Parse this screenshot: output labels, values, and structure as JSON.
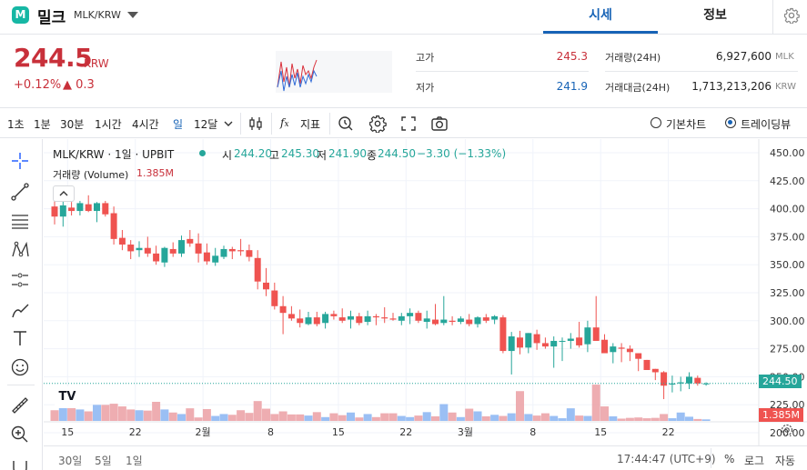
{
  "header": {
    "coin_name": "밀크",
    "pair": "MLK/KRW",
    "tabs": [
      "시세",
      "정보"
    ],
    "active_tab": 0
  },
  "price": {
    "current": "244.5",
    "unit": "KRW",
    "change_pct": "+0.12%",
    "change_abs": "▲ 0.3",
    "stats": {
      "high_label": "고가",
      "high_value": "245.3",
      "low_label": "저가",
      "low_value": "241.9",
      "volume_label": "거래량(24H)",
      "volume_value": "6,927,600",
      "volume_unit": "MLK",
      "amount_label": "거래대금(24H)",
      "amount_value": "1,713,213,206",
      "amount_unit": "KRW"
    }
  },
  "toolbar": {
    "intervals": [
      "1초",
      "1분",
      "30분",
      "1시간",
      "4시간",
      "일",
      "12달"
    ],
    "active_interval": "일",
    "fx_label": "지표",
    "mode_basic": "기본차트",
    "mode_trading": "트레이딩뷰"
  },
  "chart": {
    "legend_title": "MLK/KRW · 1일 · UPBIT",
    "ohlc": {
      "o_label": "시",
      "o": "244.20",
      "h_label": "고",
      "h": "245.30",
      "l_label": "저",
      "l": "241.90",
      "c_label": "종",
      "c": "244.50",
      "chg": "−3.30 (−1.33%)"
    },
    "volume_label": "거래량 (Volume)",
    "volume_value": "1.385M",
    "logo_text": "TV",
    "y_ticks": [
      "450.00",
      "425.00",
      "400.00",
      "375.00",
      "350.00",
      "325.00",
      "300.00",
      "275.00",
      "250.00",
      "225.00",
      "200.00"
    ],
    "x_ticks": [
      "15",
      "22",
      "2월",
      "8",
      "15",
      "22",
      "3월",
      "8",
      "15",
      "22"
    ],
    "last_price_tag": "244.50",
    "last_volume_tag": "1.385M",
    "ranges": [
      "30일",
      "5일",
      "1일"
    ],
    "clock": "17:44:47 (UTC+9)",
    "pct_label": "%",
    "log_label": "로그",
    "auto_label": "자동"
  },
  "colors": {
    "up": "#26a69a",
    "down": "#ef5350",
    "accent": "#1763b6",
    "price_red": "#c8303a"
  },
  "chart_data": {
    "type": "candlestick",
    "title": "MLK/KRW · 1일 · UPBIT",
    "ylim": [
      200,
      450
    ],
    "candles": [
      {
        "o": 402,
        "h": 408,
        "l": 386,
        "c": 393
      },
      {
        "o": 393,
        "h": 410,
        "l": 384,
        "c": 403
      },
      {
        "o": 401,
        "h": 406,
        "l": 394,
        "c": 398
      },
      {
        "o": 398,
        "h": 407,
        "l": 394,
        "c": 405
      },
      {
        "o": 404,
        "h": 412,
        "l": 397,
        "c": 398
      },
      {
        "o": 398,
        "h": 406,
        "l": 388,
        "c": 405
      },
      {
        "o": 405,
        "h": 407,
        "l": 393,
        "c": 395
      },
      {
        "o": 396,
        "h": 402,
        "l": 368,
        "c": 373
      },
      {
        "o": 374,
        "h": 381,
        "l": 363,
        "c": 368
      },
      {
        "o": 368,
        "h": 372,
        "l": 355,
        "c": 362
      },
      {
        "o": 363,
        "h": 371,
        "l": 357,
        "c": 365
      },
      {
        "o": 365,
        "h": 375,
        "l": 357,
        "c": 360
      },
      {
        "o": 360,
        "h": 367,
        "l": 350,
        "c": 353
      },
      {
        "o": 352,
        "h": 366,
        "l": 348,
        "c": 365
      },
      {
        "o": 364,
        "h": 370,
        "l": 357,
        "c": 360
      },
      {
        "o": 360,
        "h": 376,
        "l": 357,
        "c": 372
      },
      {
        "o": 373,
        "h": 381,
        "l": 366,
        "c": 369
      },
      {
        "o": 369,
        "h": 378,
        "l": 352,
        "c": 360
      },
      {
        "o": 361,
        "h": 369,
        "l": 350,
        "c": 353
      },
      {
        "o": 352,
        "h": 365,
        "l": 349,
        "c": 358
      },
      {
        "o": 357,
        "h": 367,
        "l": 355,
        "c": 364
      },
      {
        "o": 364,
        "h": 366,
        "l": 355,
        "c": 362
      },
      {
        "o": 363,
        "h": 373,
        "l": 358,
        "c": 362
      },
      {
        "o": 363,
        "h": 368,
        "l": 353,
        "c": 357
      },
      {
        "o": 356,
        "h": 363,
        "l": 328,
        "c": 335
      },
      {
        "o": 334,
        "h": 347,
        "l": 322,
        "c": 328
      },
      {
        "o": 327,
        "h": 334,
        "l": 310,
        "c": 313
      },
      {
        "o": 313,
        "h": 322,
        "l": 288,
        "c": 307
      },
      {
        "o": 306,
        "h": 313,
        "l": 300,
        "c": 302
      },
      {
        "o": 302,
        "h": 310,
        "l": 294,
        "c": 298
      },
      {
        "o": 297,
        "h": 308,
        "l": 296,
        "c": 303
      },
      {
        "o": 303,
        "h": 308,
        "l": 295,
        "c": 297
      },
      {
        "o": 298,
        "h": 308,
        "l": 293,
        "c": 306
      },
      {
        "o": 306,
        "h": 309,
        "l": 301,
        "c": 304
      },
      {
        "o": 303,
        "h": 311,
        "l": 298,
        "c": 300
      },
      {
        "o": 301,
        "h": 309,
        "l": 293,
        "c": 304
      },
      {
        "o": 304,
        "h": 307,
        "l": 296,
        "c": 298
      },
      {
        "o": 299,
        "h": 309,
        "l": 296,
        "c": 304
      },
      {
        "o": 304,
        "h": 306,
        "l": 296,
        "c": 303
      },
      {
        "o": 303,
        "h": 312,
        "l": 298,
        "c": 302
      },
      {
        "o": 302,
        "h": 307,
        "l": 300,
        "c": 301
      },
      {
        "o": 300,
        "h": 307,
        "l": 296,
        "c": 304
      },
      {
        "o": 304,
        "h": 311,
        "l": 297,
        "c": 307
      },
      {
        "o": 307,
        "h": 309,
        "l": 298,
        "c": 300
      },
      {
        "o": 299,
        "h": 309,
        "l": 293,
        "c": 302
      },
      {
        "o": 301,
        "h": 315,
        "l": 296,
        "c": 297
      },
      {
        "o": 298,
        "h": 322,
        "l": 296,
        "c": 301
      },
      {
        "o": 300,
        "h": 304,
        "l": 296,
        "c": 299
      },
      {
        "o": 299,
        "h": 304,
        "l": 297,
        "c": 302
      },
      {
        "o": 301,
        "h": 306,
        "l": 295,
        "c": 297
      },
      {
        "o": 297,
        "h": 304,
        "l": 294,
        "c": 303
      },
      {
        "o": 303,
        "h": 306,
        "l": 298,
        "c": 300
      },
      {
        "o": 301,
        "h": 305,
        "l": 297,
        "c": 304
      },
      {
        "o": 303,
        "h": 305,
        "l": 271,
        "c": 273
      },
      {
        "o": 273,
        "h": 290,
        "l": 252,
        "c": 286
      },
      {
        "o": 285,
        "h": 291,
        "l": 270,
        "c": 276
      },
      {
        "o": 276,
        "h": 289,
        "l": 271,
        "c": 289
      },
      {
        "o": 288,
        "h": 292,
        "l": 274,
        "c": 280
      },
      {
        "o": 280,
        "h": 285,
        "l": 275,
        "c": 277
      },
      {
        "o": 277,
        "h": 286,
        "l": 258,
        "c": 282
      },
      {
        "o": 282,
        "h": 285,
        "l": 264,
        "c": 282
      },
      {
        "o": 282,
        "h": 289,
        "l": 275,
        "c": 284
      },
      {
        "o": 285,
        "h": 299,
        "l": 276,
        "c": 278
      },
      {
        "o": 279,
        "h": 300,
        "l": 272,
        "c": 294
      },
      {
        "o": 294,
        "h": 322,
        "l": 283,
        "c": 282
      },
      {
        "o": 283,
        "h": 288,
        "l": 273,
        "c": 271
      },
      {
        "o": 272,
        "h": 280,
        "l": 262,
        "c": 277
      },
      {
        "o": 276,
        "h": 280,
        "l": 263,
        "c": 275
      },
      {
        "o": 275,
        "h": 278,
        "l": 264,
        "c": 272
      },
      {
        "o": 271,
        "h": 270,
        "l": 255,
        "c": 266
      },
      {
        "o": 265,
        "h": 258,
        "l": 257,
        "c": 256
      },
      {
        "o": 257,
        "h": 256,
        "l": 247,
        "c": 254
      },
      {
        "o": 254,
        "h": 255,
        "l": 230,
        "c": 242
      },
      {
        "o": 243,
        "h": 251,
        "l": 236,
        "c": 244
      },
      {
        "o": 244,
        "h": 250,
        "l": 237,
        "c": 245
      },
      {
        "o": 244,
        "h": 254,
        "l": 239,
        "c": 250
      },
      {
        "o": 249,
        "h": 251,
        "l": 242,
        "c": 244
      },
      {
        "o": 244,
        "h": 245,
        "l": 242,
        "c": 244
      }
    ],
    "volume_relative": [
      0.28,
      0.44,
      0.76,
      0.3,
      0.25,
      0.42,
      0.42,
      0.45,
      0.38,
      0.3,
      0.28,
      0.27,
      0.5,
      0.3,
      0.22,
      0.18,
      0.33,
      0.09,
      0.31,
      0.13,
      0.18,
      0.16,
      0.28,
      0.21,
      0.52,
      0.32,
      0.18,
      0.25,
      0.17,
      0.17,
      0.14,
      0.23,
      0.1,
      0.2,
      0.15,
      0.22,
      0.09,
      0.18,
      0.1,
      0.2,
      0.2,
      0.13,
      0.1,
      0.14,
      0.23,
      0.12,
      0.44,
      0.22,
      0.1,
      0.32,
      0.25,
      0.12,
      0.16,
      0.13,
      0.2,
      0.78,
      0.18,
      0.14,
      0.2,
      0.13,
      0.07,
      0.33,
      0.14,
      0.13,
      0.95,
      0.38,
      0.12,
      0.06,
      0.08,
      0.09,
      0.07,
      0.08,
      0.18,
      0.07,
      0.22,
      0.11,
      0.05,
      0.04
    ]
  }
}
